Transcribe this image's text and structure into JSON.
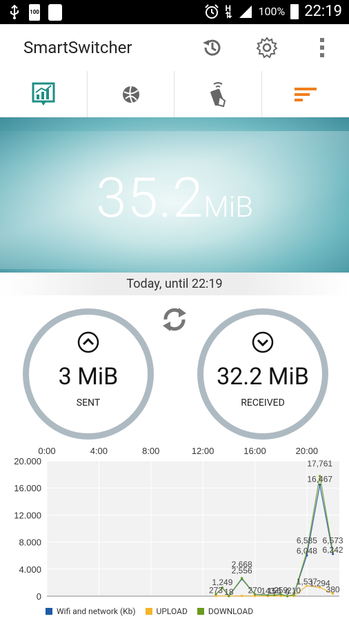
{
  "status_bar": {
    "battery_percent": "100%",
    "time": "22:19",
    "left_icons": [
      "usb-icon",
      "battery-100-icon",
      "galaxy-icon"
    ],
    "right_icons": [
      "alarm-icon",
      "hspa-icon",
      "signal-icon",
      "battery-icon"
    ],
    "left_badge": "100"
  },
  "appbar": {
    "title": "SmartSwitcher",
    "actions": [
      "history-icon",
      "settings-icon",
      "overflow-menu-icon"
    ]
  },
  "tabs": [
    {
      "name": "chart-tab",
      "icon": "usage-chart-icon",
      "active": true
    },
    {
      "name": "network-tab",
      "icon": "globe-icon",
      "active": false
    },
    {
      "name": "device-tab",
      "icon": "phone-tap-icon",
      "active": false
    },
    {
      "name": "filter-tab",
      "icon": "sort-lines-icon",
      "active": false
    }
  ],
  "hero": {
    "value": "35.2",
    "unit": "MiB"
  },
  "period_label": "Today, until 22:19",
  "sent": {
    "value": "3 MiB",
    "label": "SENT"
  },
  "received": {
    "value": "32.2 MiB",
    "label": "RECEIVED"
  },
  "colors": {
    "accent_teal": "#1f8f86",
    "accent_orange": "#f07f1d",
    "circle_ring": "#aebac2",
    "series_wifi": "#1f5aa6",
    "series_upload": "#f3b52b",
    "series_download": "#6b9a1e"
  },
  "chart_data": {
    "type": "line",
    "x_ticks": [
      "0:00",
      "4:00",
      "8:00",
      "12:00",
      "16:00",
      "20:00"
    ],
    "y_ticks": [
      "0",
      "4.000",
      "8.000",
      "12.000",
      "16.000",
      "20.000"
    ],
    "ylim": [
      0,
      20000
    ],
    "xlim": [
      0,
      22.5
    ],
    "series": [
      {
        "name": "Wifi and network (Kb)",
        "color": "#1f5aa6",
        "points": [
          [
            13,
            273
          ],
          [
            13.5,
            1249
          ],
          [
            14,
            18
          ],
          [
            15,
            2556
          ],
          [
            16,
            270
          ],
          [
            17,
            143
          ],
          [
            17.5,
            156
          ],
          [
            18,
            259
          ],
          [
            18.5,
            0
          ],
          [
            19,
            210
          ],
          [
            20,
            6048
          ],
          [
            21,
            16467
          ],
          [
            22,
            6242
          ]
        ]
      },
      {
        "name": "UPLOAD",
        "color": "#f3b52b",
        "points": [
          [
            13,
            20
          ],
          [
            14,
            18
          ],
          [
            15,
            40
          ],
          [
            16,
            20
          ],
          [
            17,
            16
          ],
          [
            18,
            20
          ],
          [
            19,
            16
          ],
          [
            20,
            1537
          ],
          [
            21,
            1294
          ],
          [
            22,
            380
          ]
        ]
      },
      {
        "name": "DOWNLOAD",
        "color": "#6b9a1e",
        "points": [
          [
            13,
            273
          ],
          [
            13.5,
            1249
          ],
          [
            14,
            18
          ],
          [
            15,
            2668
          ],
          [
            16,
            270
          ],
          [
            17,
            143
          ],
          [
            17.5,
            156
          ],
          [
            18,
            259
          ],
          [
            18.5,
            0
          ],
          [
            19,
            210
          ],
          [
            20,
            6585
          ],
          [
            21,
            17761
          ],
          [
            22,
            6573
          ]
        ]
      }
    ],
    "value_labels": [
      "273",
      "1,249",
      "18",
      "2,556",
      "2,668",
      "270",
      "143",
      "156",
      "259",
      "0",
      "210",
      "6,585",
      "6,048",
      "1,537",
      "17,761",
      "16,467",
      "1,294",
      "6,573",
      "6,242",
      "380"
    ],
    "legend": [
      "Wifi and network (Kb)",
      "UPLOAD",
      "DOWNLOAD"
    ]
  }
}
